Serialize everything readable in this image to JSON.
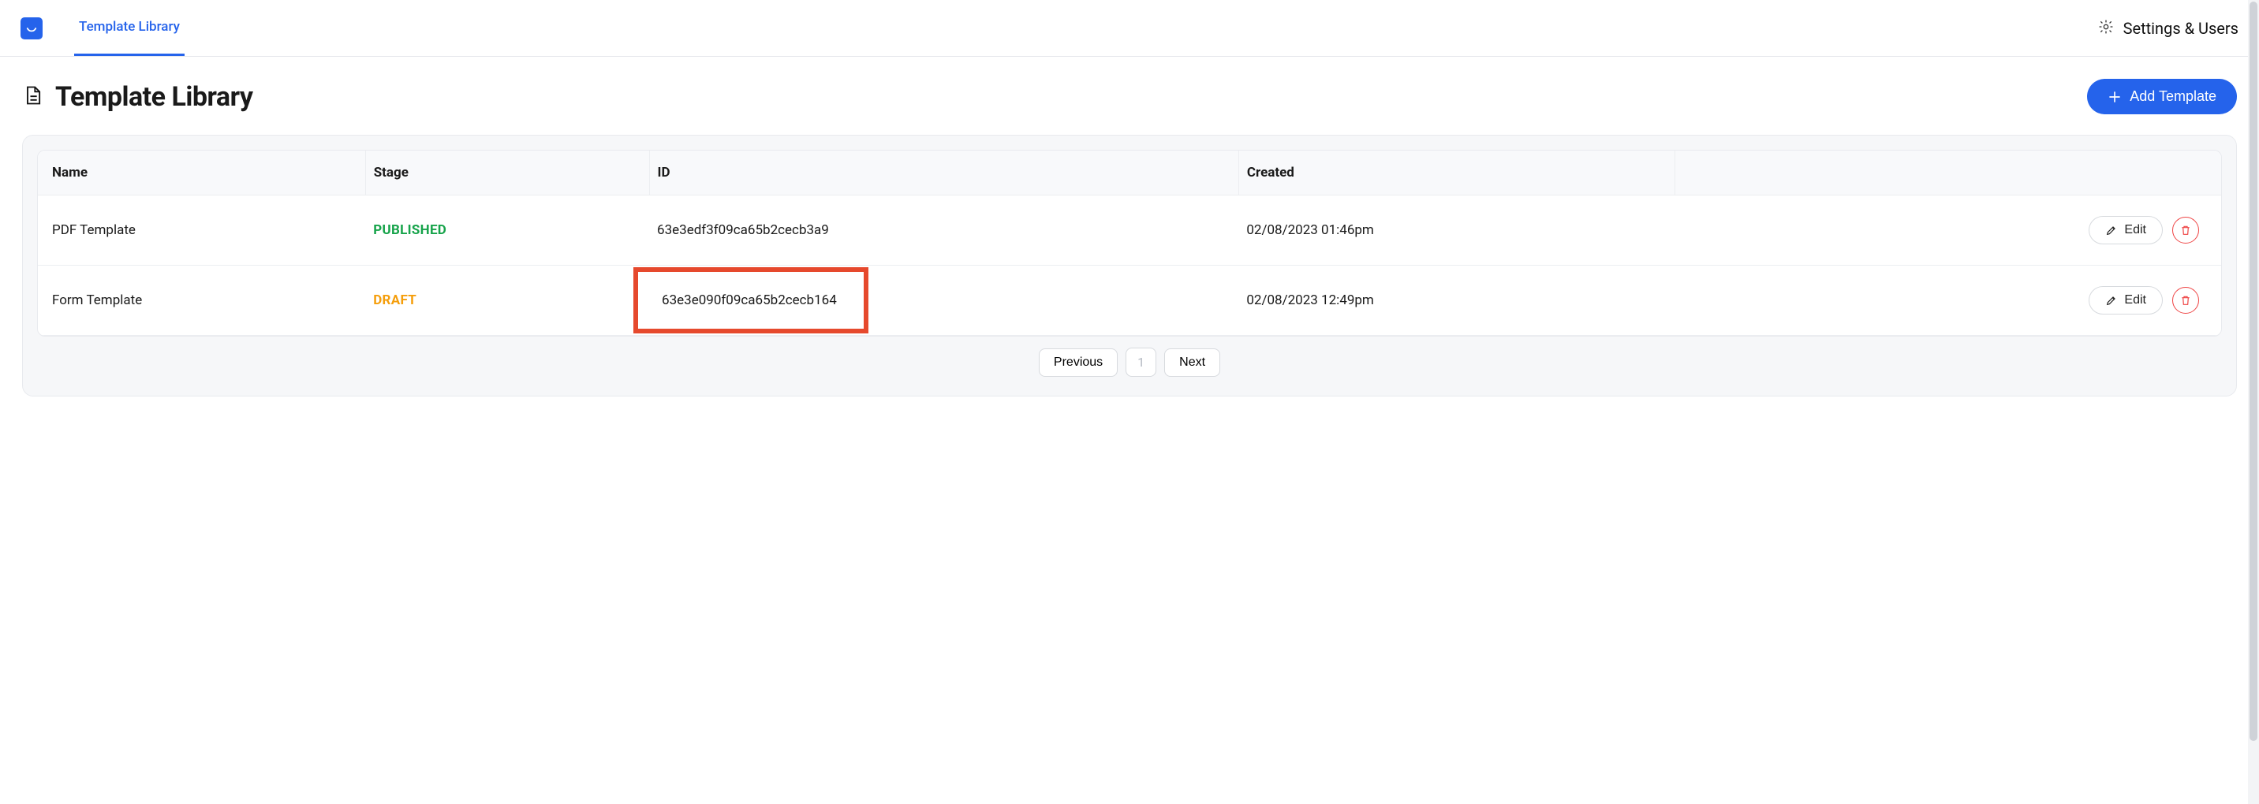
{
  "nav": {
    "tab_label": "Template Library",
    "settings_label": "Settings & Users"
  },
  "page": {
    "title": "Template Library",
    "add_button_label": "Add Template"
  },
  "table": {
    "headers": {
      "name": "Name",
      "stage": "Stage",
      "id": "ID",
      "created": "Created"
    },
    "rows": [
      {
        "name": "PDF Template",
        "stage": "PUBLISHED",
        "stage_class": "stage-published",
        "id": "63e3edf3f09ca65b2cecb3a9",
        "created": "02/08/2023 01:46pm",
        "highlight": false,
        "edit_label": "Edit"
      },
      {
        "name": "Form Template",
        "stage": "DRAFT",
        "stage_class": "stage-draft",
        "id": "63e3e090f09ca65b2cecb164",
        "created": "02/08/2023 12:49pm",
        "highlight": true,
        "edit_label": "Edit"
      }
    ]
  },
  "pager": {
    "previous": "Previous",
    "page": "1",
    "next": "Next"
  }
}
